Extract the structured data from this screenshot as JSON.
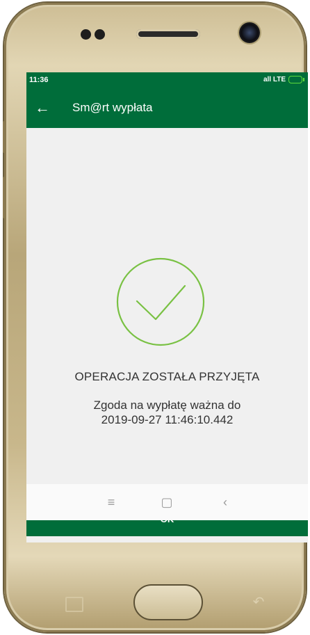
{
  "status_bar": {
    "time": "11:36",
    "signal": "all LTE"
  },
  "app_bar": {
    "title": "Sm@rt wypłata",
    "back_icon": "arrow-left-icon"
  },
  "result": {
    "icon": "check-circle-icon",
    "status_title": "OPERACJA ZOSTAŁA PRZYJĘTA",
    "validity_line1": "Zgoda na wypłatę ważna do",
    "validity_line2": "2019-09-27 11:46:10.442"
  },
  "actions": {
    "ok_label": "OK"
  },
  "nav": {
    "menu_icon": "≡",
    "home_icon": "▢",
    "back_icon": "‹"
  },
  "colors": {
    "brand_green": "#006d3a",
    "check_green": "#79c143",
    "background": "#f0f0f0"
  }
}
